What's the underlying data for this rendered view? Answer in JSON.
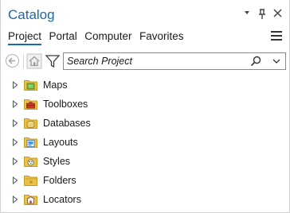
{
  "pane": {
    "title": "Catalog",
    "buttons": {
      "options": "▾",
      "pin": "📌",
      "close": "✕"
    }
  },
  "tabs": [
    {
      "label": "Project",
      "active": true
    },
    {
      "label": "Portal",
      "active": false
    },
    {
      "label": "Computer",
      "active": false
    },
    {
      "label": "Favorites",
      "active": false
    }
  ],
  "search": {
    "placeholder": "Search Project"
  },
  "tree": {
    "items": [
      {
        "label": "Maps",
        "icon": "maps-folder-icon"
      },
      {
        "label": "Toolboxes",
        "icon": "toolboxes-folder-icon"
      },
      {
        "label": "Databases",
        "icon": "databases-folder-icon"
      },
      {
        "label": "Layouts",
        "icon": "layouts-folder-icon"
      },
      {
        "label": "Styles",
        "icon": "styles-folder-icon"
      },
      {
        "label": "Folders",
        "icon": "folders-folder-icon"
      },
      {
        "label": "Locators",
        "icon": "locators-folder-icon"
      }
    ]
  },
  "colors": {
    "accent": "#1b6aa8",
    "folder": "#e8c24a",
    "folder_dark": "#c99a1c"
  }
}
